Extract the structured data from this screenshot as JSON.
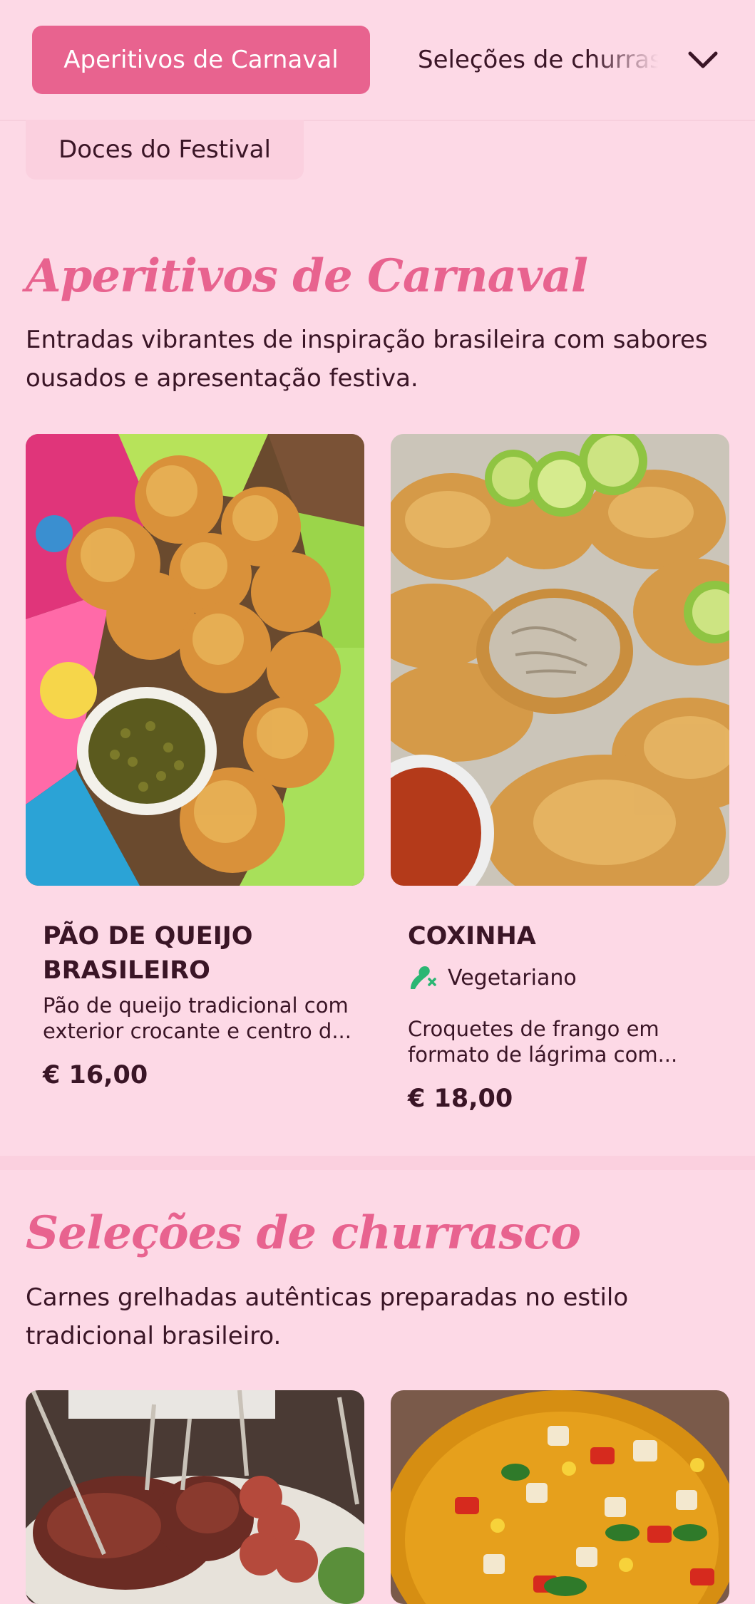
{
  "nav": {
    "categories": [
      {
        "label": "Aperitivos de Carnaval"
      },
      {
        "label": "Seleções de churrasco"
      },
      {
        "label": "Doces do Festival"
      }
    ]
  },
  "sections": [
    {
      "title": "Aperitivos de Carnaval",
      "description": "Entradas vibrantes de inspiração brasileira com sabores ousados e apresentação festiva.",
      "items": [
        {
          "name_line1": "PÃO DE QUEIJO",
          "name_line2": "BRASILEIRO",
          "description_line1": "Pão de queijo tradicional com",
          "description_line2": "exterior crocante e centro d...",
          "price": "€ 16,00"
        },
        {
          "name_line1": "COXINHA",
          "tag": "Vegetariano",
          "description_line1": "Croquetes de frango em",
          "description_line2": "formato de lágrima com...",
          "price": "€ 18,00"
        }
      ]
    },
    {
      "title": "Seleções de churrasco",
      "description": "Carnes grelhadas autênticas preparadas no estilo tradicional brasileiro."
    }
  ],
  "icons": {
    "dropdown": "chevron-down-icon",
    "tag": "vegetarian-icon"
  },
  "colors": {
    "background": "#fdd9e6",
    "accent": "#e8638f",
    "text": "#3a1526",
    "tag_icon": "#2bb673"
  }
}
